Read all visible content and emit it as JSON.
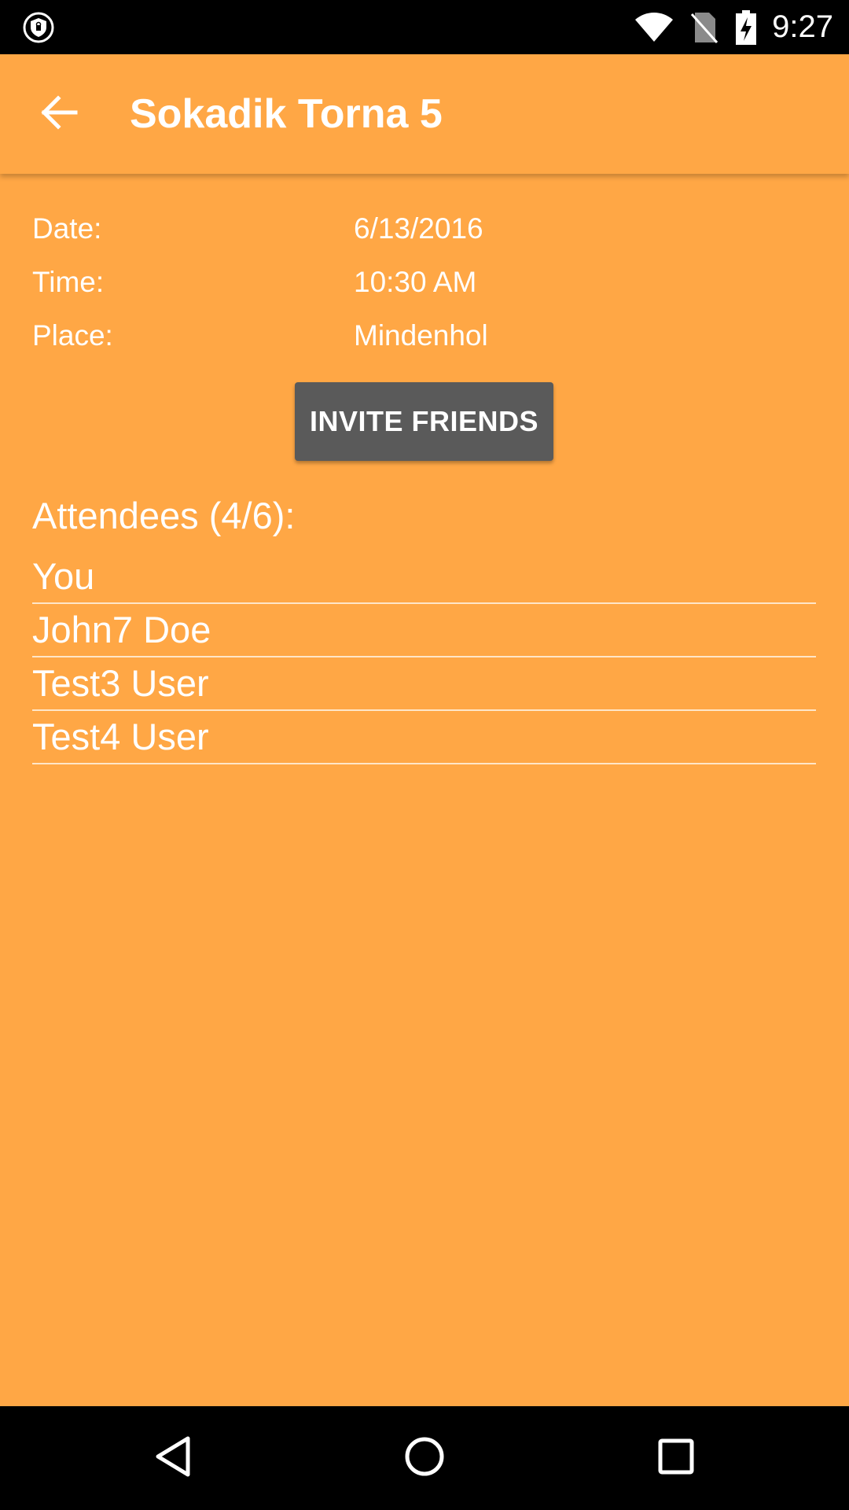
{
  "status_bar": {
    "time": "9:27",
    "icons": [
      "shield-icon",
      "wifi-icon",
      "no-sim-icon",
      "battery-charging-icon"
    ]
  },
  "app_bar": {
    "title": "Sokadik Torna 5",
    "back_icon": "arrow-back-icon"
  },
  "details": [
    {
      "label": "Date:",
      "value": "6/13/2016"
    },
    {
      "label": "Time:",
      "value": "10:30 AM"
    },
    {
      "label": "Place:",
      "value": "Mindenhol"
    }
  ],
  "invite_button": {
    "label": "INVITE FRIENDS"
  },
  "attendees": {
    "title": "Attendees (4/6):",
    "items": [
      "You",
      "John7 Doe",
      "Test3 User",
      "Test4 User"
    ]
  },
  "nav_bar": {
    "icons": [
      "back-triangle-icon",
      "home-circle-icon",
      "recents-square-icon"
    ]
  },
  "colors": {
    "background": "#FFA745",
    "button": "#5A5A5A",
    "text": "#FFFFFF",
    "system_bars": "#000000"
  }
}
